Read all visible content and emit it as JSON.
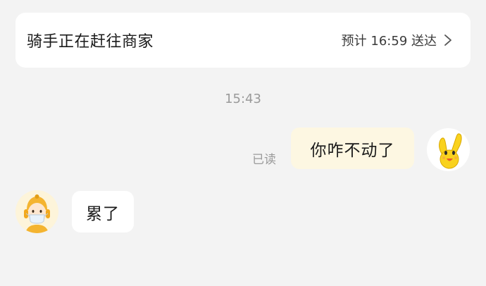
{
  "order_status": {
    "title": "骑手正在赶往商家",
    "eta": "预计 16:59 送达",
    "chevron_icon": "chevron-right-icon"
  },
  "chat": {
    "timestamp": "15:43",
    "messages": [
      {
        "direction": "outgoing",
        "text": "你咋不动了",
        "read_status": "已读",
        "avatar_icon": "yellow-hand-mascot-avatar"
      },
      {
        "direction": "incoming",
        "text": "累了",
        "avatar_icon": "rider-with-headset-avatar"
      }
    ]
  },
  "colors": {
    "background": "#f3f3f3",
    "outgoing_bubble": "#fdf7e2",
    "incoming_bubble": "#ffffff",
    "muted_text": "#9a9a9a"
  }
}
